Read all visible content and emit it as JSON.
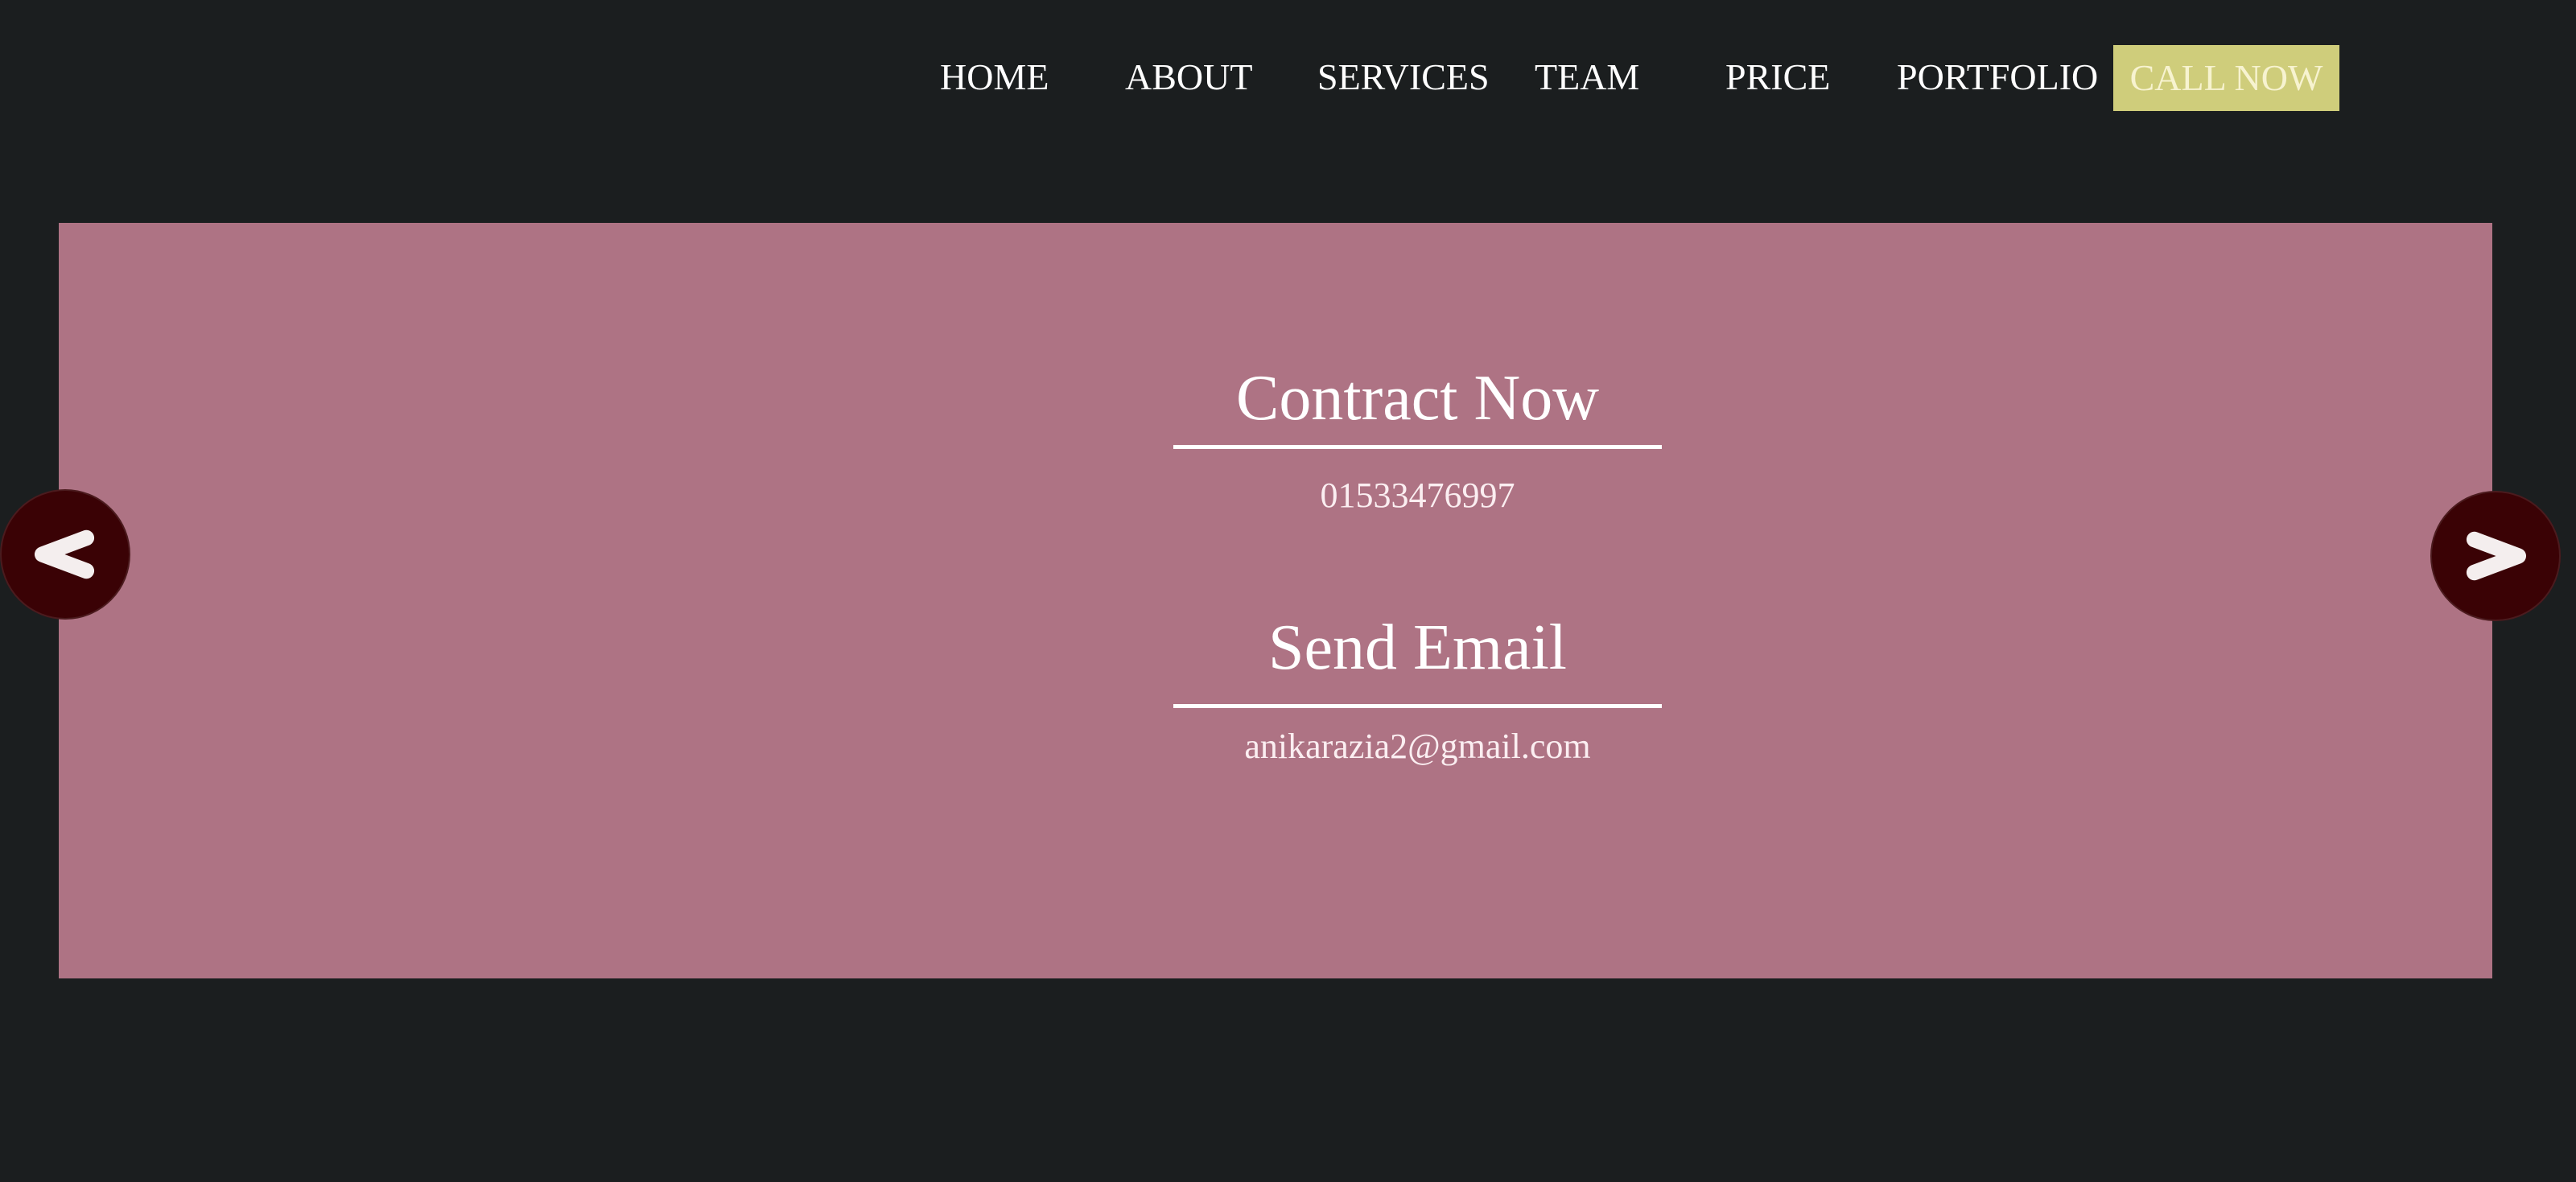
{
  "nav": {
    "items": [
      {
        "label": "HOME"
      },
      {
        "label": "ABOUT"
      },
      {
        "label": "SERVICES"
      },
      {
        "label": "TEAM"
      },
      {
        "label": "PRICE"
      },
      {
        "label": "PORTFOLIO"
      }
    ],
    "cta_label": "CALL NOW"
  },
  "slider": {
    "phone_heading": "Contract Now",
    "phone_number": "01533476997",
    "email_heading": "Send Email",
    "email_address": "anikarazia2@gmail.com",
    "prev_icon": "chevron-left-icon",
    "next_icon": "chevron-right-icon"
  },
  "colors": {
    "page_background": "#1b1e1f",
    "slider_background": "#ae7384",
    "cta_background": "#cfcd7b",
    "arrow_background": "#3a0205",
    "text": "#ffffff"
  }
}
